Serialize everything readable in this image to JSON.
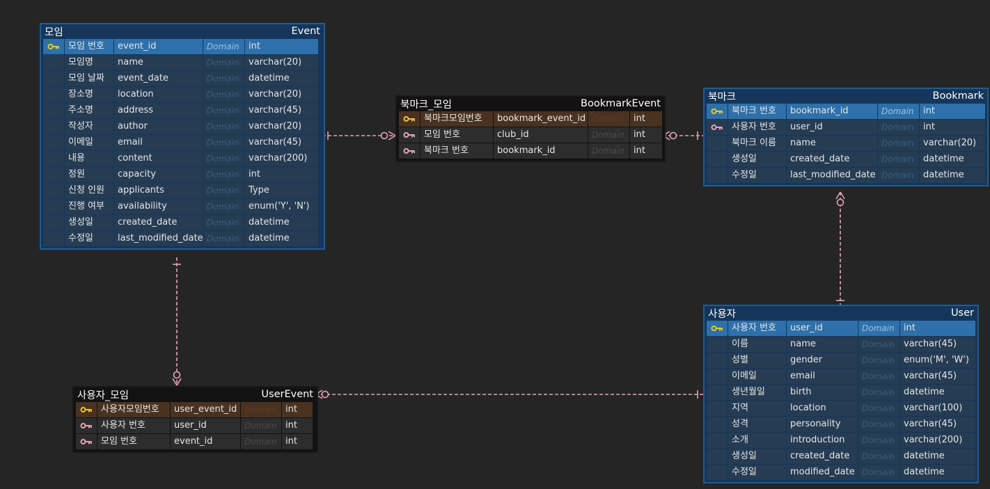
{
  "colors": {
    "background": "#252525",
    "connector": "#e8a5b4",
    "pk_key": "#e9c92c",
    "fk_key": "#e8a5b4"
  },
  "entities": {
    "event": {
      "title_ko": "모임",
      "title_en": "Event",
      "rows": [
        {
          "key": "pk",
          "ko": "모임 번호",
          "col": "event_id",
          "dom": "Domain",
          "type": "int"
        },
        {
          "key": "",
          "ko": "모임명",
          "col": "name",
          "dom": "Domain",
          "type": "varchar(20)"
        },
        {
          "key": "",
          "ko": "모임 날짜",
          "col": "event_date",
          "dom": "Domain",
          "type": "datetime"
        },
        {
          "key": "",
          "ko": "장소명",
          "col": "location",
          "dom": "Domain",
          "type": "varchar(20)"
        },
        {
          "key": "",
          "ko": "주소명",
          "col": "address",
          "dom": "Domain",
          "type": "varchar(45)"
        },
        {
          "key": "",
          "ko": "작성자",
          "col": "author",
          "dom": "Domain",
          "type": "varchar(20)"
        },
        {
          "key": "",
          "ko": "이메일",
          "col": "email",
          "dom": "Domain",
          "type": "varchar(45)"
        },
        {
          "key": "",
          "ko": "내용",
          "col": "content",
          "dom": "Domain",
          "type": "varchar(200)"
        },
        {
          "key": "",
          "ko": "정원",
          "col": "capacity",
          "dom": "Domain",
          "type": "int"
        },
        {
          "key": "",
          "ko": "신청 인원",
          "col": "applicants",
          "dom": "Domain",
          "type": "Type"
        },
        {
          "key": "",
          "ko": "진행 여부",
          "col": "availability",
          "dom": "Domain",
          "type": "enum('Y', 'N')"
        },
        {
          "key": "",
          "ko": "생성일",
          "col": "created_date",
          "dom": "Domain",
          "type": "datetime"
        },
        {
          "key": "",
          "ko": "수정일",
          "col": "last_modified_date",
          "dom": "Domain",
          "type": "datetime"
        }
      ]
    },
    "bookmark_event": {
      "title_ko": "북마크_모임",
      "title_en": "BookmarkEvent",
      "rows": [
        {
          "key": "pk",
          "ko": "북마크모임번호",
          "col": "bookmark_event_id",
          "dom": "Domain",
          "type": "int"
        },
        {
          "key": "fk",
          "ko": "모임 번호",
          "col": "club_id",
          "dom": "Domain",
          "type": "int"
        },
        {
          "key": "fk",
          "ko": "북마크 번호",
          "col": "bookmark_id",
          "dom": "Domain",
          "type": "int"
        }
      ]
    },
    "bookmark": {
      "title_ko": "북마크",
      "title_en": "Bookmark",
      "rows": [
        {
          "key": "pk",
          "ko": "북마크 번호",
          "col": "bookmark_id",
          "dom": "Domain",
          "type": "int"
        },
        {
          "key": "fk",
          "ko": "사용자 번호",
          "col": "user_id",
          "dom": "Domain",
          "type": "int"
        },
        {
          "key": "",
          "ko": "북마크 이름",
          "col": "name",
          "dom": "Domain",
          "type": "varchar(20)"
        },
        {
          "key": "",
          "ko": "생성일",
          "col": "created_date",
          "dom": "Domain",
          "type": "datetime"
        },
        {
          "key": "",
          "ko": "수정일",
          "col": "last_modified_date",
          "dom": "Domain",
          "type": "datetime"
        }
      ]
    },
    "user_event": {
      "title_ko": "사용자_모임",
      "title_en": "UserEvent",
      "rows": [
        {
          "key": "pk",
          "ko": "사용자모임번호",
          "col": "user_event_id",
          "dom": "Domain",
          "type": "int"
        },
        {
          "key": "fk",
          "ko": "사용자 번호",
          "col": "user_id",
          "dom": "Domain",
          "type": "int"
        },
        {
          "key": "fk",
          "ko": "모임 번호",
          "col": "event_id",
          "dom": "Domain",
          "type": "int"
        }
      ]
    },
    "user": {
      "title_ko": "사용자",
      "title_en": "User",
      "rows": [
        {
          "key": "pk",
          "ko": "사용자 번호",
          "col": "user_id",
          "dom": "Domain",
          "type": "int"
        },
        {
          "key": "",
          "ko": "이름",
          "col": "name",
          "dom": "Domain",
          "type": "varchar(45)"
        },
        {
          "key": "",
          "ko": "성별",
          "col": "gender",
          "dom": "Domain",
          "type": "enum('M', 'W')"
        },
        {
          "key": "",
          "ko": "이메일",
          "col": "email",
          "dom": "Domain",
          "type": "varchar(45)"
        },
        {
          "key": "",
          "ko": "생년월일",
          "col": "birth",
          "dom": "Domain",
          "type": "datetime"
        },
        {
          "key": "",
          "ko": "지역",
          "col": "location",
          "dom": "Domain",
          "type": "varchar(100)"
        },
        {
          "key": "",
          "ko": "성격",
          "col": "personality",
          "dom": "Domain",
          "type": "varchar(45)"
        },
        {
          "key": "",
          "ko": "소개",
          "col": "introduction",
          "dom": "Domain",
          "type": "varchar(200)"
        },
        {
          "key": "",
          "ko": "생성일",
          "col": "created_date",
          "dom": "Domain",
          "type": "datetime"
        },
        {
          "key": "",
          "ko": "수정일",
          "col": "modified_date",
          "dom": "Domain",
          "type": "datetime"
        }
      ]
    }
  }
}
